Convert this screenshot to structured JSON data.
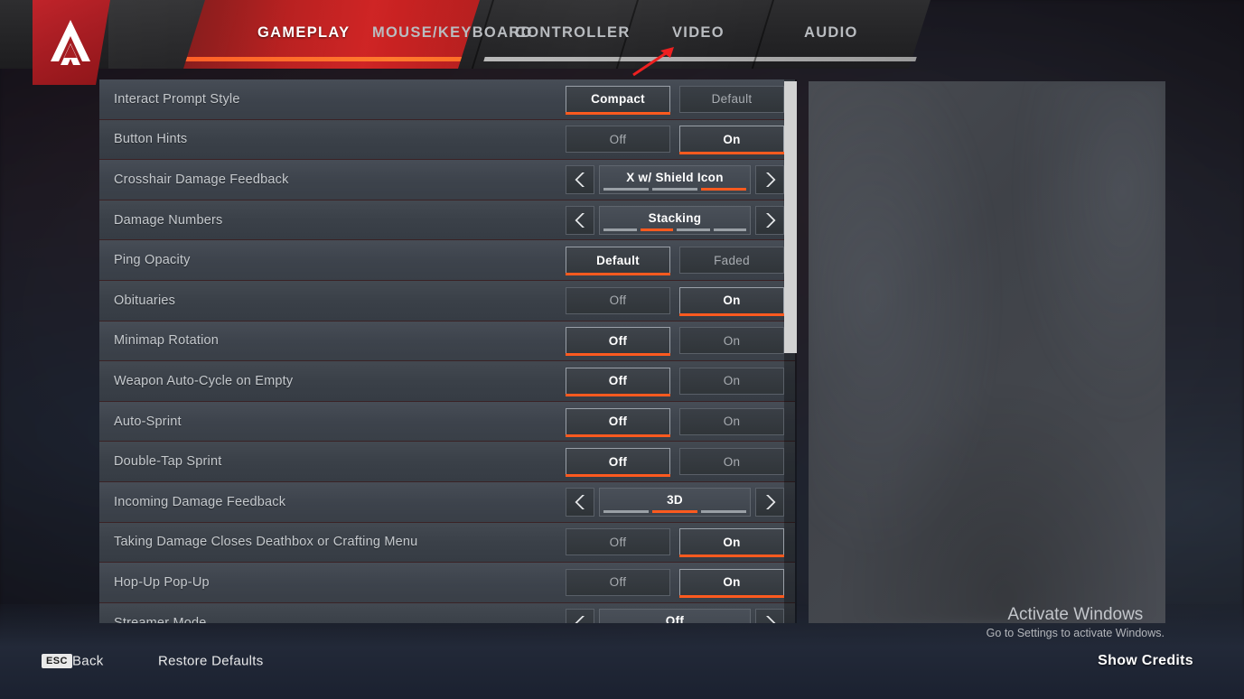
{
  "brand": {
    "logo_icon": "apex-legends-logo-icon"
  },
  "tabs": [
    {
      "label": "GAMEPLAY",
      "active": true
    },
    {
      "label": "MOUSE/KEYBOARD",
      "active": false
    },
    {
      "label": "CONTROLLER",
      "active": false
    },
    {
      "label": "VIDEO",
      "active": false
    },
    {
      "label": "AUDIO",
      "active": false
    }
  ],
  "annotation": {
    "arrow_icon": "red-pointer-arrow-icon",
    "color": "#ee2020",
    "points_to": "VIDEO"
  },
  "settings": [
    {
      "label": "Interact Prompt Style",
      "type": "toggle",
      "options": [
        "Compact",
        "Default"
      ],
      "selected": 0
    },
    {
      "label": "Button Hints",
      "type": "toggle",
      "options": [
        "Off",
        "On"
      ],
      "selected": 1
    },
    {
      "label": "Crosshair Damage Feedback",
      "type": "stepper",
      "value": "X w/ Shield Icon",
      "segments": 3,
      "index": 2
    },
    {
      "label": "Damage Numbers",
      "type": "stepper",
      "value": "Stacking",
      "segments": 4,
      "index": 1
    },
    {
      "label": "Ping Opacity",
      "type": "toggle",
      "options": [
        "Default",
        "Faded"
      ],
      "selected": 0
    },
    {
      "label": "Obituaries",
      "type": "toggle",
      "options": [
        "Off",
        "On"
      ],
      "selected": 1
    },
    {
      "label": "Minimap Rotation",
      "type": "toggle",
      "options": [
        "Off",
        "On"
      ],
      "selected": 0
    },
    {
      "label": "Weapon Auto-Cycle on Empty",
      "type": "toggle",
      "options": [
        "Off",
        "On"
      ],
      "selected": 0
    },
    {
      "label": "Auto-Sprint",
      "type": "toggle",
      "options": [
        "Off",
        "On"
      ],
      "selected": 0
    },
    {
      "label": "Double-Tap Sprint",
      "type": "toggle",
      "options": [
        "Off",
        "On"
      ],
      "selected": 0
    },
    {
      "label": "Incoming Damage Feedback",
      "type": "stepper",
      "value": "3D",
      "segments": 3,
      "index": 1
    },
    {
      "label": "Taking Damage Closes Deathbox or Crafting Menu",
      "type": "toggle",
      "options": [
        "Off",
        "On"
      ],
      "selected": 1
    },
    {
      "label": "Hop-Up Pop-Up",
      "type": "toggle",
      "options": [
        "Off",
        "On"
      ],
      "selected": 1
    },
    {
      "label": "Streamer Mode",
      "type": "stepper",
      "value": "Off",
      "segments": 2,
      "index": 0
    }
  ],
  "scrollbar": {
    "orientation": "vertical",
    "thumb_top_pct": 0,
    "thumb_size_pct": 50
  },
  "footer": {
    "esc_key": "ESC",
    "back_label": "Back",
    "restore_defaults": "Restore Defaults",
    "show_credits": "Show Credits"
  },
  "watermark": {
    "line1": "Activate Windows",
    "line2": "Go to Settings to activate Windows."
  },
  "colors": {
    "accent_orange": "#ff5a1f",
    "brand_red": "#b81d1d",
    "row_bg": "#414750",
    "label_text": "#c6cace",
    "annotation_red": "#ee2020"
  }
}
